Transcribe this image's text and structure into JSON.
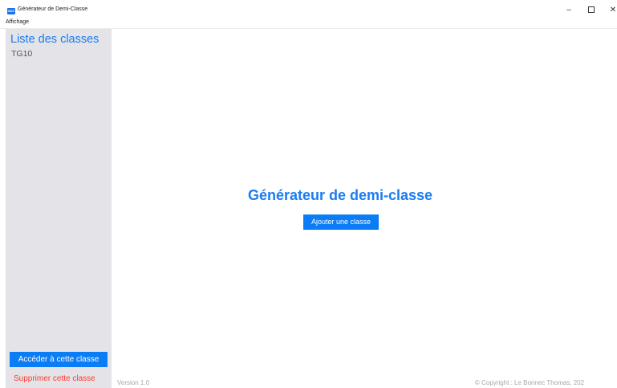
{
  "window": {
    "title": "Générateur de Demi-Classe",
    "icon_label": "GDC",
    "controls": {
      "minimize": "–",
      "close": "✕"
    }
  },
  "menu": {
    "items": [
      "Affichage"
    ]
  },
  "sidebar": {
    "title": "Liste des classes",
    "classes": [
      "TG10"
    ],
    "access_label": "Accéder à cette classe",
    "delete_label": "Supprimer cette classe"
  },
  "main": {
    "title": "Générateur de demi-classe",
    "add_class_label": "Ajouter une classe"
  },
  "footer": {
    "version": "Version 1.0",
    "copyright": "© Copyright : Le Bonnec Thomas, 202"
  },
  "colors": {
    "accent": "#0a7cf5",
    "title_blue": "#1a7cf0",
    "sidebar_bg": "#e3e3e8",
    "danger": "#ff3b30"
  }
}
